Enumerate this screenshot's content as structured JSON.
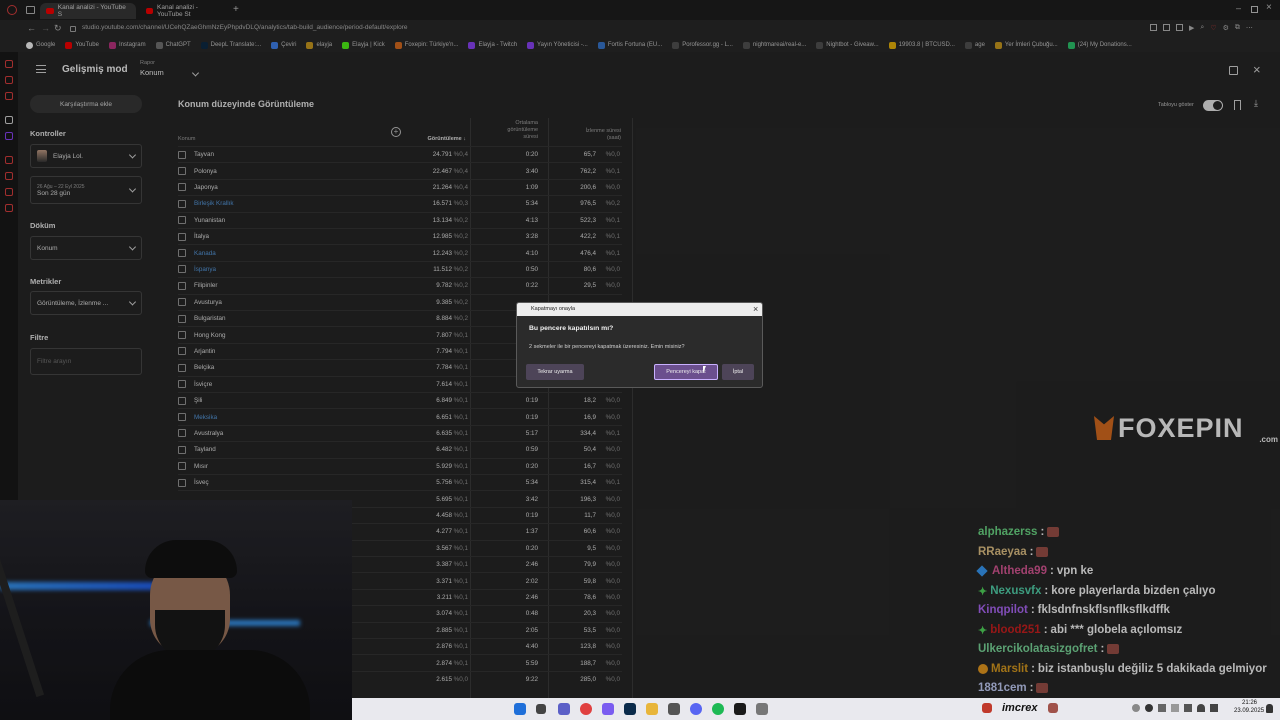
{
  "browser": {
    "tabs": [
      {
        "label": "Kanal analizi - YouTube S"
      },
      {
        "label": "Kanal analizi - YouTube St"
      }
    ],
    "url": "studio.youtube.com/channel/UCehQZaeGhmNzEyPhpdvDLQ/analytics/tab-build_audience/period-default/explore",
    "bookmarks": [
      "Google",
      "YouTube",
      "Instagram",
      "ChatGPT",
      "DeepL Translate:...",
      "Çeviri",
      "elayja",
      "Elayja | Kick",
      "Foxepin: Türkiye'n...",
      "Elayja - Twitch",
      "Yayın Yöneticisi -...",
      "Fortis Fortuna (EU...",
      "Porofessor.gg - L...",
      "nightmareai/real-e...",
      "Nightbot - Giveaw...",
      "19903.8 | BTCUSD...",
      "age",
      "Yer İmleri Çubuğu...",
      "(24) My Donations..."
    ]
  },
  "header": {
    "title": "Gelişmiş mod",
    "report_label": "Rapor",
    "report_value": "Konum"
  },
  "sidebar": {
    "compare_button": "Karşılaştırma ekle",
    "controls_heading": "Kontroller",
    "channel": "Elayja Lol.",
    "date_range_small": "26 Ağu – 22 Eyl 2025",
    "date_range": "Son 28 gün",
    "breakdown_heading": "Döküm",
    "breakdown_value": "Konum",
    "metrics_heading": "Metrikler",
    "metrics_value": "Görüntüleme, İzlenme ...",
    "filter_heading": "Filtre",
    "filter_placeholder": "Filtre arayın"
  },
  "content": {
    "title": "Konum düzeyinde Görüntüleme",
    "show_table_label": "Tabloyu göster",
    "columns": {
      "location": "Konum",
      "views": "Görüntüleme",
      "avg_duration": [
        "Ortalama",
        "görüntüleme",
        "süresi"
      ],
      "watch_time": [
        "İzlenme süresi",
        "(saat)"
      ]
    },
    "rows": [
      {
        "name": "Tayvan",
        "views": "24.791",
        "vp": "%0,4",
        "avg": "0:20",
        "wt": "65,7",
        "wp": "%0,0",
        "link": false
      },
      {
        "name": "Polonya",
        "views": "22.467",
        "vp": "%0,4",
        "avg": "3:40",
        "wt": "762,2",
        "wp": "%0,1",
        "link": false
      },
      {
        "name": "Japonya",
        "views": "21.264",
        "vp": "%0,4",
        "avg": "1:09",
        "wt": "200,6",
        "wp": "%0,0",
        "link": false
      },
      {
        "name": "Birleşik Krallık",
        "views": "16.571",
        "vp": "%0,3",
        "avg": "5:34",
        "wt": "976,5",
        "wp": "%0,2",
        "link": true
      },
      {
        "name": "Yunanistan",
        "views": "13.134",
        "vp": "%0,2",
        "avg": "4:13",
        "wt": "522,3",
        "wp": "%0,1",
        "link": false
      },
      {
        "name": "İtalya",
        "views": "12.985",
        "vp": "%0,2",
        "avg": "3:28",
        "wt": "422,2",
        "wp": "%0,1",
        "link": false
      },
      {
        "name": "Kanada",
        "views": "12.243",
        "vp": "%0,2",
        "avg": "4:10",
        "wt": "476,4",
        "wp": "%0,1",
        "link": true
      },
      {
        "name": "İspanya",
        "views": "11.512",
        "vp": "%0,2",
        "avg": "0:50",
        "wt": "80,6",
        "wp": "%0,0",
        "link": true
      },
      {
        "name": "Filipinler",
        "views": "9.782",
        "vp": "%0,2",
        "avg": "0:22",
        "wt": "29,5",
        "wp": "%0,0",
        "link": false
      },
      {
        "name": "Avusturya",
        "views": "9.385",
        "vp": "%0,2",
        "avg": "",
        "wt": "",
        "wp": "",
        "link": false
      },
      {
        "name": "Bulgaristan",
        "views": "8.884",
        "vp": "%0,2",
        "avg": "",
        "wt": "",
        "wp": "",
        "link": false
      },
      {
        "name": "Hong Kong",
        "views": "7.807",
        "vp": "%0,1",
        "avg": "",
        "wt": "",
        "wp": "",
        "link": false
      },
      {
        "name": "Arjantin",
        "views": "7.794",
        "vp": "%0,1",
        "avg": "",
        "wt": "",
        "wp": "",
        "link": false
      },
      {
        "name": "Belçika",
        "views": "7.784",
        "vp": "%0,1",
        "avg": "",
        "wt": "",
        "wp": "",
        "link": false
      },
      {
        "name": "İsviçre",
        "views": "7.614",
        "vp": "%0,1",
        "avg": "",
        "wt": "",
        "wp": "",
        "link": false
      },
      {
        "name": "Şili",
        "views": "6.849",
        "vp": "%0,1",
        "avg": "0:19",
        "wt": "18,2",
        "wp": "%0,0",
        "link": false
      },
      {
        "name": "Meksika",
        "views": "6.651",
        "vp": "%0,1",
        "avg": "0:19",
        "wt": "16,9",
        "wp": "%0,0",
        "link": true
      },
      {
        "name": "Avustralya",
        "views": "6.635",
        "vp": "%0,1",
        "avg": "5:17",
        "wt": "334,4",
        "wp": "%0,1",
        "link": false
      },
      {
        "name": "Tayland",
        "views": "6.482",
        "vp": "%0,1",
        "avg": "0:59",
        "wt": "50,4",
        "wp": "%0,0",
        "link": false
      },
      {
        "name": "Mısır",
        "views": "5.929",
        "vp": "%0,1",
        "avg": "0:20",
        "wt": "16,7",
        "wp": "%0,0",
        "link": false
      },
      {
        "name": "İsveç",
        "views": "5.756",
        "vp": "%0,1",
        "avg": "5:34",
        "wt": "315,4",
        "wp": "%0,1",
        "link": false
      },
      {
        "name": "",
        "views": "5.695",
        "vp": "%0,1",
        "avg": "3:42",
        "wt": "196,3",
        "wp": "%0,0",
        "link": false
      },
      {
        "name": "",
        "views": "4.458",
        "vp": "%0,1",
        "avg": "0:19",
        "wt": "11,7",
        "wp": "%0,0",
        "link": false
      },
      {
        "name": "",
        "views": "4.277",
        "vp": "%0,1",
        "avg": "1:37",
        "wt": "60,6",
        "wp": "%0,0",
        "link": false
      },
      {
        "name": "",
        "views": "3.567",
        "vp": "%0,1",
        "avg": "0:20",
        "wt": "9,5",
        "wp": "%0,0",
        "link": false
      },
      {
        "name": "",
        "views": "3.387",
        "vp": "%0,1",
        "avg": "2:46",
        "wt": "79,9",
        "wp": "%0,0",
        "link": false
      },
      {
        "name": "",
        "views": "3.371",
        "vp": "%0,1",
        "avg": "2:02",
        "wt": "59,8",
        "wp": "%0,0",
        "link": false
      },
      {
        "name": "",
        "views": "3.211",
        "vp": "%0,1",
        "avg": "2:46",
        "wt": "78,6",
        "wp": "%0,0",
        "link": false
      },
      {
        "name": "",
        "views": "3.074",
        "vp": "%0,1",
        "avg": "0:48",
        "wt": "20,3",
        "wp": "%0,0",
        "link": false
      },
      {
        "name": "",
        "views": "2.885",
        "vp": "%0,1",
        "avg": "2:05",
        "wt": "53,5",
        "wp": "%0,0",
        "link": false
      },
      {
        "name": "",
        "views": "2.876",
        "vp": "%0,1",
        "avg": "4:40",
        "wt": "123,8",
        "wp": "%0,0",
        "link": false
      },
      {
        "name": "",
        "views": "2.874",
        "vp": "%0,1",
        "avg": "5:59",
        "wt": "188,7",
        "wp": "%0,0",
        "link": false
      },
      {
        "name": "",
        "views": "2.615",
        "vp": "%0,0",
        "avg": "9:22",
        "wt": "285,0",
        "wp": "%0,0",
        "link": false
      }
    ]
  },
  "dialog": {
    "titlebar": "Kapatmayı onayla",
    "heading": "Bu pencere kapatılsın mı?",
    "message": "2 sekmeler ile bir pencereyi kapatmak üzeresiniz. Emin misiniz?",
    "dont_warn": "Tekrar uyarma",
    "close_window": "Pencereyi kapat",
    "cancel": "İptal"
  },
  "overlay": {
    "brand": "FOXEPIN",
    "brand_tld": ".com"
  },
  "chat": [
    {
      "user": "alphazerss",
      "color": "#6fe08a",
      "msg": "",
      "emote": true,
      "badge": ""
    },
    {
      "user": "RRaeyaa",
      "color": "#e8c88a",
      "msg": "",
      "emote": true,
      "badge": ""
    },
    {
      "user": "Altheda99",
      "color": "#e05a9a",
      "msg": "vpn ke",
      "emote": false,
      "badge": "gem"
    },
    {
      "user": "Nexusvfx",
      "color": "#55d8b0",
      "msg": "kore playerlarda bizden çalıyo",
      "emote": false,
      "badge": "star"
    },
    {
      "user": "Kinqpilot",
      "color": "#b36bff",
      "msg": "fklsdnfnskflsnflksflkdffk",
      "emote": false,
      "badge": ""
    },
    {
      "user": "blood251",
      "color": "#d22020",
      "msg": "abi *** globela açılomsız",
      "emote": false,
      "badge": "star"
    },
    {
      "user": "Ulkercikolatasizgofret",
      "color": "#7fe0a0",
      "msg": "",
      "emote": true,
      "badge": ""
    },
    {
      "user": "Marslit",
      "color": "#e0a020",
      "msg": "biz istanbuşlu değiliz 5 dakikada gelmiyor",
      "emote": false,
      "badge": "alert"
    },
    {
      "user": "1881cem",
      "color": "#c9d4ff",
      "msg": "",
      "emote": true,
      "badge": ""
    }
  ],
  "taskbar": {
    "streamer_name": "imcrex",
    "time": "21:26",
    "date": "23.09.2025"
  }
}
